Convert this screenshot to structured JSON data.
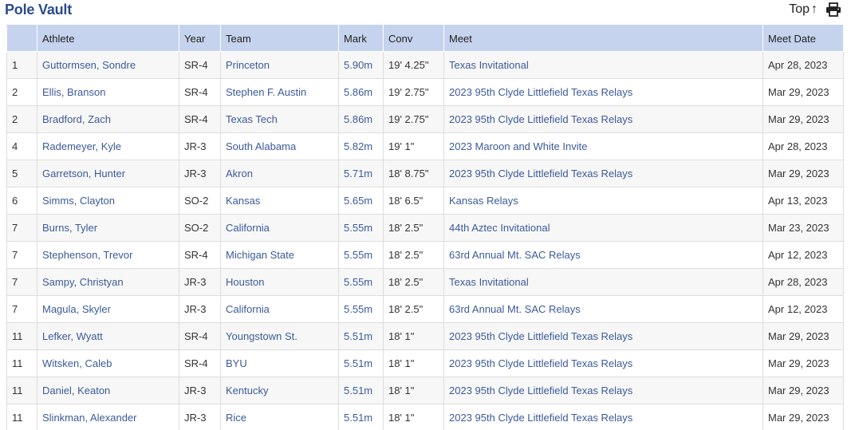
{
  "header": {
    "event_title": "Pole Vault",
    "top_label": "Top",
    "top_arrow": "↑"
  },
  "table": {
    "columns": [
      "",
      "Athlete",
      "Year",
      "Team",
      "Mark",
      "Conv",
      "Meet",
      "Meet Date"
    ],
    "rows": [
      {
        "place": "1",
        "athlete": "Guttormsen, Sondre",
        "year": "SR-4",
        "team": "Princeton",
        "mark": "5.90m",
        "conv": "19' 4.25\"",
        "meet": "Texas Invitational",
        "date": "Apr 28, 2023"
      },
      {
        "place": "2",
        "athlete": "Ellis, Branson",
        "year": "SR-4",
        "team": "Stephen F. Austin",
        "mark": "5.86m",
        "conv": "19' 2.75\"",
        "meet": "2023 95th Clyde Littlefield Texas Relays",
        "date": "Mar 29, 2023"
      },
      {
        "place": "2",
        "athlete": "Bradford, Zach",
        "year": "SR-4",
        "team": "Texas Tech",
        "mark": "5.86m",
        "conv": "19' 2.75\"",
        "meet": "2023 95th Clyde Littlefield Texas Relays",
        "date": "Mar 29, 2023"
      },
      {
        "place": "4",
        "athlete": "Rademeyer, Kyle",
        "year": "JR-3",
        "team": "South Alabama",
        "mark": "5.82m",
        "conv": "19' 1\"",
        "meet": "2023 Maroon and White Invite",
        "date": "Apr 28, 2023"
      },
      {
        "place": "5",
        "athlete": "Garretson, Hunter",
        "year": "JR-3",
        "team": "Akron",
        "mark": "5.71m",
        "conv": "18' 8.75\"",
        "meet": "2023 95th Clyde Littlefield Texas Relays",
        "date": "Mar 29, 2023"
      },
      {
        "place": "6",
        "athlete": "Simms, Clayton",
        "year": "SO-2",
        "team": "Kansas",
        "mark": "5.65m",
        "conv": "18' 6.5\"",
        "meet": "Kansas Relays",
        "date": "Apr 13, 2023"
      },
      {
        "place": "7",
        "athlete": "Burns, Tyler",
        "year": "SO-2",
        "team": "California",
        "mark": "5.55m",
        "conv": "18' 2.5\"",
        "meet": "44th Aztec Invitational",
        "date": "Mar 23, 2023"
      },
      {
        "place": "7",
        "athlete": "Stephenson, Trevor",
        "year": "SR-4",
        "team": "Michigan State",
        "mark": "5.55m",
        "conv": "18' 2.5\"",
        "meet": "63rd Annual Mt. SAC Relays",
        "date": "Apr 12, 2023"
      },
      {
        "place": "7",
        "athlete": "Sampy, Christyan",
        "year": "JR-3",
        "team": "Houston",
        "mark": "5.55m",
        "conv": "18' 2.5\"",
        "meet": "Texas Invitational",
        "date": "Apr 28, 2023"
      },
      {
        "place": "7",
        "athlete": "Magula, Skyler",
        "year": "JR-3",
        "team": "California",
        "mark": "5.55m",
        "conv": "18' 2.5\"",
        "meet": "63rd Annual Mt. SAC Relays",
        "date": "Apr 12, 2023"
      },
      {
        "place": "11",
        "athlete": "Lefker, Wyatt",
        "year": "SR-4",
        "team": "Youngstown St.",
        "mark": "5.51m",
        "conv": "18' 1\"",
        "meet": "2023 95th Clyde Littlefield Texas Relays",
        "date": "Mar 29, 2023"
      },
      {
        "place": "11",
        "athlete": "Witsken, Caleb",
        "year": "SR-4",
        "team": "BYU",
        "mark": "5.51m",
        "conv": "18' 1\"",
        "meet": "2023 95th Clyde Littlefield Texas Relays",
        "date": "Mar 29, 2023"
      },
      {
        "place": "11",
        "athlete": "Daniel, Keaton",
        "year": "JR-3",
        "team": "Kentucky",
        "mark": "5.51m",
        "conv": "18' 1\"",
        "meet": "2023 95th Clyde Littlefield Texas Relays",
        "date": "Mar 29, 2023"
      },
      {
        "place": "11",
        "athlete": "Slinkman, Alexander",
        "year": "JR-3",
        "team": "Rice",
        "mark": "5.51m",
        "conv": "18' 1\"",
        "meet": "2023 95th Clyde Littlefield Texas Relays",
        "date": "Mar 29, 2023"
      }
    ]
  },
  "icons": {
    "print": "print-icon"
  },
  "colors": {
    "title": "#2a4b8d",
    "header_bg": "#c6d3ee",
    "link": "#3b5a9a",
    "row_alt": "#f7f7f7"
  }
}
